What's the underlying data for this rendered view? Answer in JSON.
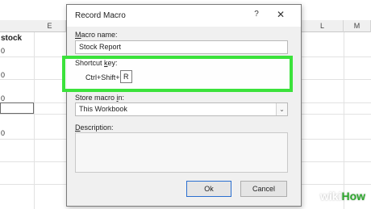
{
  "sheet": {
    "columns": [
      "E",
      "L",
      "M"
    ],
    "cells": {
      "a1": "stock",
      "a2": "0",
      "a3": "0",
      "a4": "0",
      "a5": "0"
    }
  },
  "dialog": {
    "title": "Record Macro",
    "help": "?",
    "close": "✕",
    "macro_name_label_pre": "",
    "macro_name_label_ul": "M",
    "macro_name_label_post": "acro name:",
    "macro_name_value": "Stock Report",
    "shortcut_label_pre": "Shortcut ",
    "shortcut_label_ul": "k",
    "shortcut_label_post": "ey:",
    "shortcut_prefix": "Ctrl+Shift+",
    "shortcut_value": "R",
    "store_label_pre": "Store macro ",
    "store_label_ul": "i",
    "store_label_post": "n:",
    "store_value": "This Workbook",
    "store_arrow": "⌄",
    "description_label_pre": "",
    "description_label_ul": "D",
    "description_label_post": "escription:",
    "ok_label": "Ok",
    "cancel_label": "Cancel"
  },
  "watermark": {
    "wiki": "wiki",
    "how": "How"
  }
}
